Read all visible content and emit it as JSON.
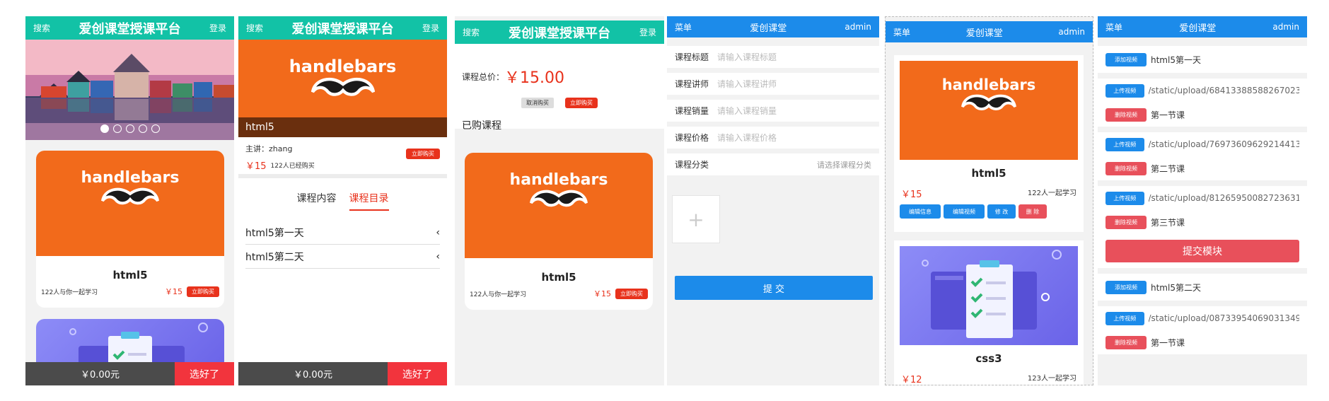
{
  "panel1": {
    "header": {
      "left": "搜索",
      "title": "爱创课堂授课平台",
      "right": "登录"
    },
    "card1": {
      "logo": "handlebars",
      "name": "html5",
      "learners": "122人与你一起学习",
      "price": "￥15",
      "buy": "立即购买"
    },
    "bottom": {
      "total": "￥0.00元",
      "go": "选好了"
    }
  },
  "panel2": {
    "header": {
      "left": "搜索",
      "title": "爱创课堂授课平台",
      "right": "登录"
    },
    "logo": "handlebars",
    "course_title": "html5",
    "teacher": "主讲：zhang",
    "price": "￥15",
    "buyers": "122人已经购买",
    "buy": "立即购买",
    "tabs": [
      "课程内容",
      "课程目录"
    ],
    "lessons": [
      "html5第一天",
      "html5第二天"
    ],
    "bottom": {
      "total": "￥0.00元",
      "go": "选好了"
    }
  },
  "panel3": {
    "header": {
      "left": "搜索",
      "title": "爱创课堂授课平台",
      "right": "登录"
    },
    "total_label": "课程总价：",
    "total_value": "￥15.00",
    "cancel": "取消购买",
    "buy": "立即购买",
    "bought": "已购课程",
    "card": {
      "logo": "handlebars",
      "name": "html5",
      "learners": "122人与你一起学习",
      "price": "￥15",
      "buy": "立即购买"
    }
  },
  "panel4": {
    "header": {
      "left": "菜单",
      "title": "爱创课堂",
      "right": "admin"
    },
    "fields": [
      {
        "label": "课程标题",
        "placeholder": "请输入课程标题"
      },
      {
        "label": "课程讲师",
        "placeholder": "请输入课程讲师"
      },
      {
        "label": "课程销量",
        "placeholder": "请输入课程销量"
      },
      {
        "label": "课程价格",
        "placeholder": "请输入课程价格"
      }
    ],
    "category_label": "课程分类",
    "category_placeholder": "请选择课程分类",
    "upload_glyph": "+",
    "submit": "提 交"
  },
  "panel5": {
    "header": {
      "left": "菜单",
      "title": "爱创课堂",
      "right": "admin"
    },
    "card1": {
      "logo": "handlebars",
      "name": "html5",
      "price": "￥15",
      "learners": "122人一起学习",
      "buttons": [
        "编辑信息",
        "编辑视频",
        "修 改",
        "删 除"
      ]
    },
    "card2": {
      "name": "css3",
      "price": "￥12",
      "learners": "123人一起学习"
    }
  },
  "panel6": {
    "header": {
      "left": "菜单",
      "title": "爱创课堂",
      "right": "admin"
    },
    "add_video": "添加视频",
    "upload_video": "上传视频",
    "delete_video": "删除视频",
    "module1": "html5第一天",
    "module1_videos": [
      {
        "path": "/static/upload/68413388588267023...",
        "title": "第一节课"
      },
      {
        "path": "/static/upload/76973609629214413...",
        "title": "第二节课"
      },
      {
        "path": "/static/upload/81265950082723631...",
        "title": "第三节课"
      }
    ],
    "submit_module": "提交模块",
    "module2": "html5第二天",
    "module2_videos": [
      {
        "path": "/static/upload/08733954069031349...",
        "title": "第一节课"
      }
    ]
  },
  "colors": {
    "teal": "#12c2a6",
    "blue": "#1c8bea",
    "orange": "#f26a1b",
    "red": "#e8321c",
    "pink": "#e8505b"
  }
}
